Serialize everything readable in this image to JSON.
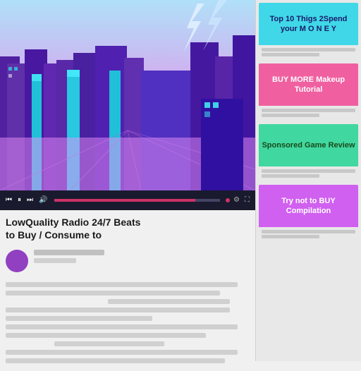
{
  "video": {
    "title_line1": "LowQuality Radio 24/7 Beats",
    "title_line2": "to Buy / Consume to",
    "scene_colors": {
      "sky": "#b8e8f8",
      "ground": "#d090e0",
      "building_main": "#6030a0",
      "building_accent": "#30d0e0"
    }
  },
  "controls": {
    "play_icon": "▶",
    "skip_icon": "⏭",
    "prev_icon": "⏮",
    "pause_icon": "⏸",
    "volume_icon": "🔊",
    "settings_icon": "⚙",
    "fullscreen_icon": "⛶"
  },
  "sidebar": {
    "card1": {
      "label": "Top 10 Thigs 2Spend your M O N E Y",
      "color_class": "cyan"
    },
    "card2": {
      "label": "BUY MORE Makeup Tutorial",
      "color_class": "pink"
    },
    "card3": {
      "label": "Sponsored Game Review",
      "color_class": "green"
    },
    "card4": {
      "label": "Try not to BUY Compilation",
      "color_class": "purple"
    }
  }
}
